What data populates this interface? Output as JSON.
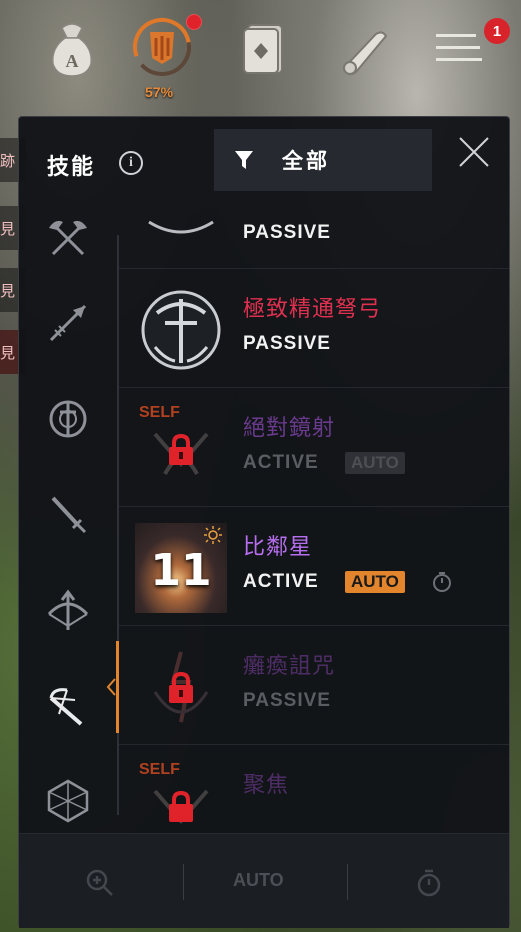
{
  "hud": {
    "icons": [
      "money-bag-icon",
      "skill-tree-icon",
      "card-icon",
      "scroll-icon",
      "menu-icon"
    ],
    "progress_text": "57%",
    "notification_count": "1"
  },
  "panel": {
    "title": "技能",
    "info_glyph": "i",
    "filter_label": "全部",
    "categories": [
      "axe-icon",
      "spear-icon",
      "shield-sword-icon",
      "dagger-icon",
      "bow-icon",
      "crossbow-icon",
      "dice-icon"
    ],
    "selected_category": "crossbow-icon"
  },
  "skills": [
    {
      "name": "",
      "type": "PASSIVE",
      "locked": false
    },
    {
      "name": "極致精通弩弓",
      "type": "PASSIVE",
      "locked": false,
      "name_color": "#e0304f"
    },
    {
      "name": "絕對鏡射",
      "type": "ACTIVE",
      "auto": "AUTO",
      "self": "SELF",
      "locked": true,
      "name_color": "#6a3a8e"
    },
    {
      "name": "比鄰星",
      "type": "ACTIVE",
      "auto": "AUTO",
      "level": "11",
      "locked": false,
      "name_color": "#b86ef0"
    },
    {
      "name": "癱瘓詛咒",
      "type": "PASSIVE",
      "locked": true,
      "name_color": "#4e2d66"
    },
    {
      "name": "聚焦",
      "type": "",
      "self": "SELF",
      "locked": true,
      "name_color": "#4e2d66"
    }
  ],
  "bottombar": {
    "auto_label": "AUTO"
  },
  "colors": {
    "accent": "#e2852c",
    "lock_red": "#e0232b"
  }
}
